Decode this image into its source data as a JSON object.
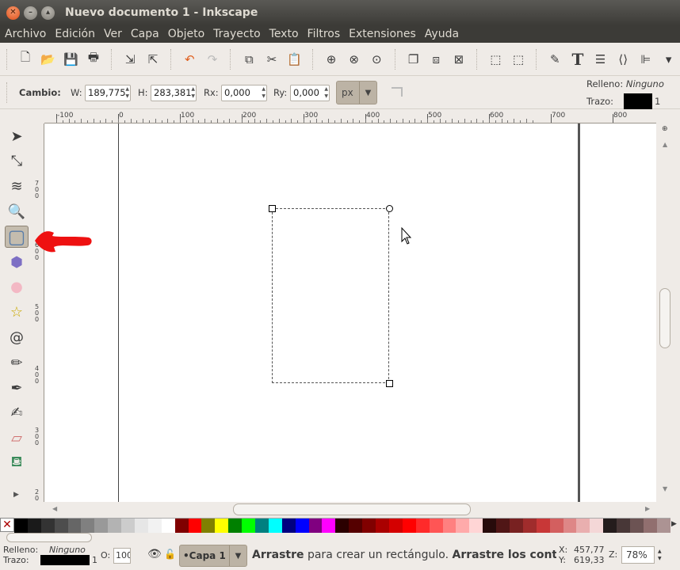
{
  "window": {
    "title": "Nuevo documento 1 - Inkscape"
  },
  "menu": [
    "Archivo",
    "Edición",
    "Ver",
    "Capa",
    "Objeto",
    "Trayecto",
    "Texto",
    "Filtros",
    "Extensiones",
    "Ayuda"
  ],
  "commands": [
    {
      "name": "new-icon",
      "glyph": "🗋"
    },
    {
      "name": "open-icon",
      "glyph": "📂"
    },
    {
      "name": "save-icon",
      "glyph": "💾"
    },
    {
      "name": "print-icon",
      "glyph": "🖶"
    },
    {
      "name": "import-icon",
      "glyph": "⇲"
    },
    {
      "name": "export-icon",
      "glyph": "⇱"
    },
    {
      "name": "undo-icon",
      "glyph": "↶"
    },
    {
      "name": "redo-icon",
      "glyph": "↷"
    },
    {
      "name": "copy-icon",
      "glyph": "⧉"
    },
    {
      "name": "cut-icon",
      "glyph": "✂"
    },
    {
      "name": "paste-icon",
      "glyph": "📋"
    },
    {
      "name": "zoom-selection-icon",
      "glyph": "⊕"
    },
    {
      "name": "zoom-drawing-icon",
      "glyph": "⊗"
    },
    {
      "name": "zoom-page-icon",
      "glyph": "⊙"
    },
    {
      "name": "duplicate-icon",
      "glyph": "❐"
    },
    {
      "name": "clone-icon",
      "glyph": "⧈"
    },
    {
      "name": "unlink-clone-icon",
      "glyph": "⊠"
    },
    {
      "name": "group-icon",
      "glyph": "⬚"
    },
    {
      "name": "ungroup-icon",
      "glyph": "⬚"
    },
    {
      "name": "fill-stroke-icon",
      "glyph": "✎"
    },
    {
      "name": "text-font-icon",
      "glyph": "T"
    },
    {
      "name": "layers-icon",
      "glyph": "☰"
    },
    {
      "name": "xml-editor-icon",
      "glyph": "⟨⟩"
    },
    {
      "name": "align-icon",
      "glyph": "⊫"
    },
    {
      "name": "more-icon",
      "glyph": "▾"
    }
  ],
  "controls": {
    "label": "Cambio:",
    "w_label": "W:",
    "w_value": "189,775",
    "h_label": "H:",
    "h_value": "283,381",
    "rx_label": "Rx:",
    "rx_value": "0,000",
    "ry_label": "Ry:",
    "ry_value": "0,000",
    "unit": "px",
    "fill_label": "Relleno:",
    "fill_value": "Ninguno",
    "stroke_label": "Trazo:",
    "stroke_width": "1",
    "stroke_color": "#000000"
  },
  "ruler": {
    "h": [
      "-100",
      "0",
      "100",
      "200",
      "300",
      "400",
      "500",
      "600",
      "700",
      "800"
    ],
    "v": [
      "7\n0\n0",
      "6\n0\n0",
      "5\n0\n0",
      "4\n0\n0",
      "3\n0\n0",
      "2\n0"
    ]
  },
  "tools": [
    {
      "name": "selector-tool-icon",
      "glyph": "➤"
    },
    {
      "name": "node-tool-icon",
      "glyph": "⤡"
    },
    {
      "name": "tweak-tool-icon",
      "glyph": "≋"
    },
    {
      "name": "zoom-tool-icon",
      "glyph": "🔍"
    },
    {
      "name": "rectangle-tool-icon",
      "glyph": "▢",
      "active": true
    },
    {
      "name": "3d-box-tool-icon",
      "glyph": "⬢"
    },
    {
      "name": "ellipse-tool-icon",
      "glyph": "●"
    },
    {
      "name": "star-tool-icon",
      "glyph": "☆"
    },
    {
      "name": "spiral-tool-icon",
      "glyph": "@"
    },
    {
      "name": "pencil-tool-icon",
      "glyph": "✏"
    },
    {
      "name": "pen-tool-icon",
      "glyph": "✒"
    },
    {
      "name": "calligraphy-tool-icon",
      "glyph": "✍"
    },
    {
      "name": "eraser-tool-icon",
      "glyph": "▱"
    },
    {
      "name": "paint-bucket-tool-icon",
      "glyph": "⛾"
    }
  ],
  "palette": [
    "#000000",
    "#1a1a1a",
    "#333333",
    "#4d4d4d",
    "#666666",
    "#808080",
    "#999999",
    "#b3b3b3",
    "#cccccc",
    "#e6e6e6",
    "#f2f2f2",
    "#ffffff",
    "#800000",
    "#ff0000",
    "#808000",
    "#ffff00",
    "#008000",
    "#00ff00",
    "#008080",
    "#00ffff",
    "#000080",
    "#0000ff",
    "#800080",
    "#ff00ff",
    "#2b0000",
    "#550000",
    "#800000",
    "#aa0000",
    "#d40000",
    "#ff0000",
    "#ff2a2a",
    "#ff5555",
    "#ff8080",
    "#ffaaaa",
    "#ffd5d5",
    "#280b0b",
    "#501616",
    "#782121",
    "#a02c2c",
    "#c83737",
    "#d35f5f",
    "#de8787",
    "#e9afaf",
    "#f4d7d7",
    "#241c1c",
    "#483737",
    "#6c5353",
    "#916f6f",
    "#ac9393"
  ],
  "status": {
    "fill_label": "Relleno:",
    "fill_value": "Ninguno",
    "stroke_label": "Trazo:",
    "stroke_width": "1",
    "opacity_label": "O:",
    "opacity_value": "100",
    "layer": "•Capa 1",
    "message_bold1": "Arrastre",
    "message_mid": " para crear un rectángulo. ",
    "message_bold2": "Arrastre los control",
    "x_label": "X:",
    "x_value": "457,77",
    "y_label": "Y:",
    "y_value": "619,33",
    "z_label": "Z:",
    "zoom_value": "78%"
  }
}
